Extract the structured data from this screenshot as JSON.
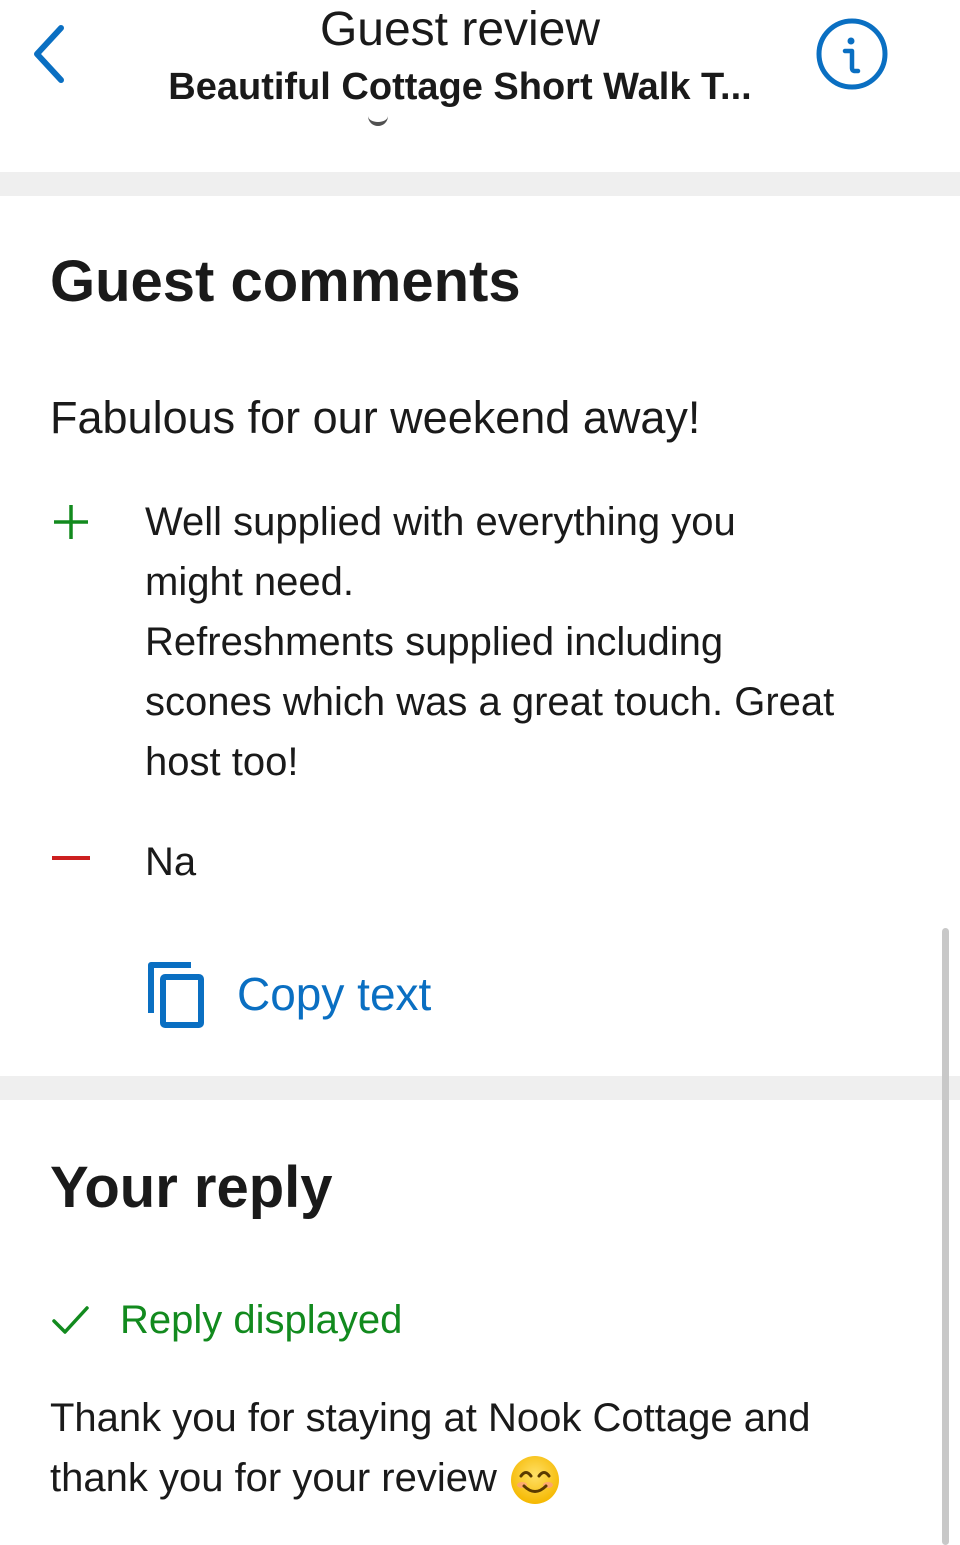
{
  "header": {
    "title": "Guest review",
    "subtitle": "Beautiful Cottage Short Walk T...",
    "back_icon": "chevron-left-icon",
    "info_icon": "info-circle-icon"
  },
  "guest_comments": {
    "section_title": "Guest comments",
    "headline": "Fabulous for our weekend away!",
    "positive_lines": [
      "Well supplied with everything you",
      "might need.",
      "Refreshments supplied including",
      "scones which was a great touch. Great",
      "host too!"
    ],
    "negative_text": "Na",
    "copy_label": "Copy text",
    "copy_icon": "copy-icon"
  },
  "reply": {
    "section_title": "Your reply",
    "status_label": "Reply displayed",
    "status_icon": "checkmark-icon",
    "text_lines": [
      "Thank you for staying at Nook Cottage and",
      "thank you for your review"
    ],
    "emoji_icon": "smiling-face-emoji-icon"
  },
  "colors": {
    "accent_blue": "#0a6fc2",
    "positive_green": "#128a1e",
    "negative_red": "#cc1f1f",
    "divider_gray": "#efefef"
  }
}
